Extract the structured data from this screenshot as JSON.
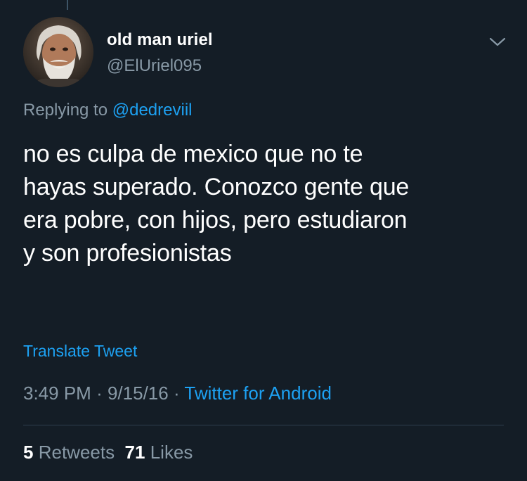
{
  "author": {
    "display_name": "old man uriel",
    "handle": "@ElUriel095",
    "avatar_icon": "profile-photo-bearded-man"
  },
  "menu_icon": "chevron-down-icon",
  "reply": {
    "prefix": "Replying to",
    "mention": "@dedreviil"
  },
  "tweet": {
    "text": "no es culpa de mexico que no te\nhayas superado. Conozco gente que\nera pobre, con hijos, pero estudiaron\ny son profesionistas",
    "translate_label": "Translate Tweet",
    "time": "3:49 PM",
    "date": "9/15/16",
    "separator": "·",
    "source": "Twitter for Android"
  },
  "stats": {
    "retweets_count": "5",
    "retweets_label": "Retweets",
    "likes_count": "71",
    "likes_label": "Likes"
  },
  "colors": {
    "background": "#141d26",
    "secondary_text": "#8899a6",
    "link": "#1da1f2"
  }
}
